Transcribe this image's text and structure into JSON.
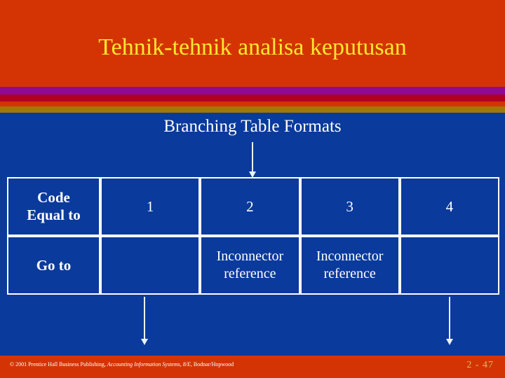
{
  "slide": {
    "title": "Tehnik-tehnik analisa keputusan",
    "subtitle": "Branching Table Formats",
    "colors": {
      "title_band": "#d43404",
      "title_text": "#ffe82e",
      "body_background": "#0a3a9c",
      "band_purple": "#8f0a92",
      "band_crimson": "#b00024",
      "band_orange": "#d43404",
      "band_gold": "#a1780a",
      "table_border": "#ffffff",
      "table_text": "#ffffff",
      "page_number": "#d9bb6a"
    }
  },
  "table": {
    "rows": [
      {
        "label": "Code Equal to",
        "label_line1": "Code",
        "label_line2": "Equal to",
        "cells": [
          "1",
          "2",
          "3",
          "4"
        ]
      },
      {
        "label": "Go to",
        "label_line1": "Go to",
        "label_line2": "",
        "cells": [
          "",
          "Inconnector reference",
          "Inconnector reference",
          ""
        ]
      }
    ]
  },
  "arrows": {
    "top": "down-arrow-into-table",
    "bottom_left": "down-arrow-from-column-1",
    "bottom_right": "down-arrow-from-column-4"
  },
  "footer": {
    "copyright_prefix": "© 2001 Prentice Hall Business Publishing, ",
    "book_title": "Accounting Information Systems, 8/E",
    "authors": ", Bodnar/Hopwood",
    "page_number": "2 - 47"
  }
}
